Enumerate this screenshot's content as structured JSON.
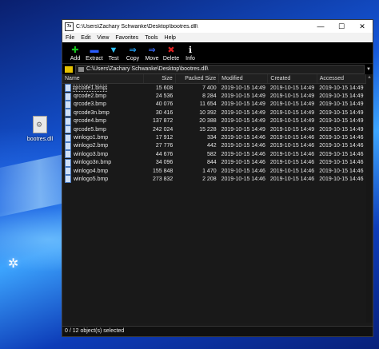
{
  "desktop": {
    "icon_label": "bootres.dll"
  },
  "window": {
    "title": "C:\\Users\\Zachary Schwanke\\Desktop\\bootres.dll\\",
    "app_icon_text": "7z",
    "controls": {
      "minimize": "—",
      "maximize": "☐",
      "close": "✕"
    }
  },
  "menu": [
    "File",
    "Edit",
    "View",
    "Favorites",
    "Tools",
    "Help"
  ],
  "toolbar": [
    {
      "label": "Add",
      "icon": "add-icon",
      "glyph": "✚",
      "color": "#19c41e"
    },
    {
      "label": "Extract",
      "icon": "extract-icon",
      "glyph": "▬",
      "color": "#2a5cff"
    },
    {
      "label": "Test",
      "icon": "test-icon",
      "glyph": "▼",
      "color": "#2fc3ff"
    },
    {
      "label": "Copy",
      "icon": "copy-icon",
      "glyph": "⇒",
      "color": "#22a8ff"
    },
    {
      "label": "Move",
      "icon": "move-icon",
      "glyph": "⇒",
      "color": "#3a6cff"
    },
    {
      "label": "Delete",
      "icon": "delete-icon",
      "glyph": "✖",
      "color": "#e12020"
    },
    {
      "label": "Info",
      "icon": "info-icon",
      "glyph": "ℹ",
      "color": "#ffffff"
    }
  ],
  "address": {
    "path": "C:\\Users\\Zachary Schwanke\\Desktop\\bootres.dll\\"
  },
  "columns": [
    "Name",
    "Size",
    "Packed Size",
    "Modified",
    "Created",
    "Accessed"
  ],
  "files": [
    {
      "name": "qrcode1.bmp",
      "size": "15 608",
      "packed": "7 400",
      "modified": "2019-10-15 14:49",
      "created": "2019-10-15 14:49",
      "accessed": "2019-10-15 14:49"
    },
    {
      "name": "qrcode2.bmp",
      "size": "24 536",
      "packed": "8 284",
      "modified": "2019-10-15 14:49",
      "created": "2019-10-15 14:49",
      "accessed": "2019-10-15 14:49"
    },
    {
      "name": "qrcode3.bmp",
      "size": "40 076",
      "packed": "11 654",
      "modified": "2019-10-15 14:49",
      "created": "2019-10-15 14:49",
      "accessed": "2019-10-15 14:49"
    },
    {
      "name": "qrcode3n.bmp",
      "size": "30 416",
      "packed": "10 392",
      "modified": "2019-10-15 14:49",
      "created": "2019-10-15 14:49",
      "accessed": "2019-10-15 14:49"
    },
    {
      "name": "qrcode4.bmp",
      "size": "137 872",
      "packed": "20 388",
      "modified": "2019-10-15 14:49",
      "created": "2019-10-15 14:49",
      "accessed": "2019-10-15 14:49"
    },
    {
      "name": "qrcode5.bmp",
      "size": "242 024",
      "packed": "15 228",
      "modified": "2019-10-15 14:49",
      "created": "2019-10-15 14:49",
      "accessed": "2019-10-15 14:49"
    },
    {
      "name": "winlogo1.bmp",
      "size": "17 912",
      "packed": "334",
      "modified": "2019-10-15 14:46",
      "created": "2019-10-15 14:46",
      "accessed": "2019-10-15 14:46"
    },
    {
      "name": "winlogo2.bmp",
      "size": "27 776",
      "packed": "442",
      "modified": "2019-10-15 14:46",
      "created": "2019-10-15 14:46",
      "accessed": "2019-10-15 14:46"
    },
    {
      "name": "winlogo3.bmp",
      "size": "44 676",
      "packed": "582",
      "modified": "2019-10-15 14:46",
      "created": "2019-10-15 14:46",
      "accessed": "2019-10-15 14:46"
    },
    {
      "name": "winlogo3n.bmp",
      "size": "34 096",
      "packed": "844",
      "modified": "2019-10-15 14:46",
      "created": "2019-10-15 14:46",
      "accessed": "2019-10-15 14:46"
    },
    {
      "name": "winlogo4.bmp",
      "size": "155 848",
      "packed": "1 470",
      "modified": "2019-10-15 14:46",
      "created": "2019-10-15 14:46",
      "accessed": "2019-10-15 14:46"
    },
    {
      "name": "winlogo5.bmp",
      "size": "273 832",
      "packed": "2 208",
      "modified": "2019-10-15 14:46",
      "created": "2019-10-15 14:46",
      "accessed": "2019-10-15 14:46"
    }
  ],
  "status": "0 / 12 object(s) selected"
}
